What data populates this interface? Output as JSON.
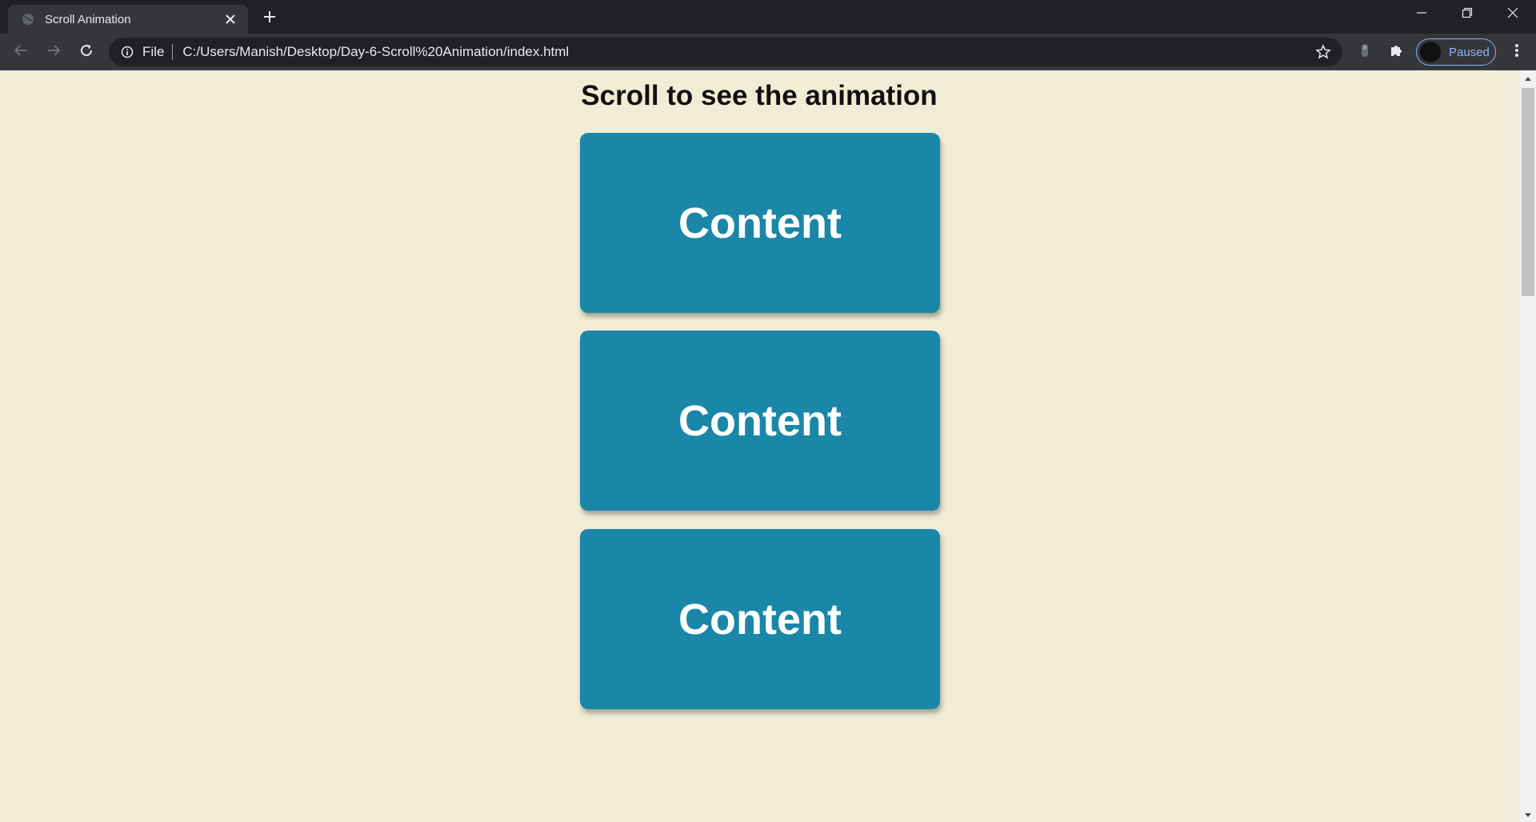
{
  "tab": {
    "title": "Scroll Animation",
    "favicon": "globe-icon",
    "close_icon": "close-icon"
  },
  "new_tab_icon": "plus-icon",
  "window_controls": [
    "minimize-icon",
    "restore-icon",
    "close-icon"
  ],
  "toolbar": {
    "back_icon": "arrow-left-icon",
    "forward_icon": "arrow-right-icon",
    "reload_icon": "reload-icon",
    "site_info_icon": "info-icon",
    "scheme_label": "File",
    "url": "C:/Users/Manish/Desktop/Day-6-Scroll%20Animation/index.html",
    "bookmark_icon": "star-icon",
    "extensions": [
      "extension-icon",
      "puzzle-icon"
    ],
    "profile_label": "Paused",
    "menu_icon": "more-vert-icon"
  },
  "page": {
    "heading": "Scroll to see the animation",
    "boxes": [
      "Content",
      "Content",
      "Content"
    ]
  },
  "colors": {
    "background": "#f0ecd5",
    "box": "#1a87a8",
    "box_text": "#ffffff",
    "chrome_dark": "#202124",
    "chrome_toolbar": "#35363a",
    "profile_accent": "#8ab4f8"
  }
}
